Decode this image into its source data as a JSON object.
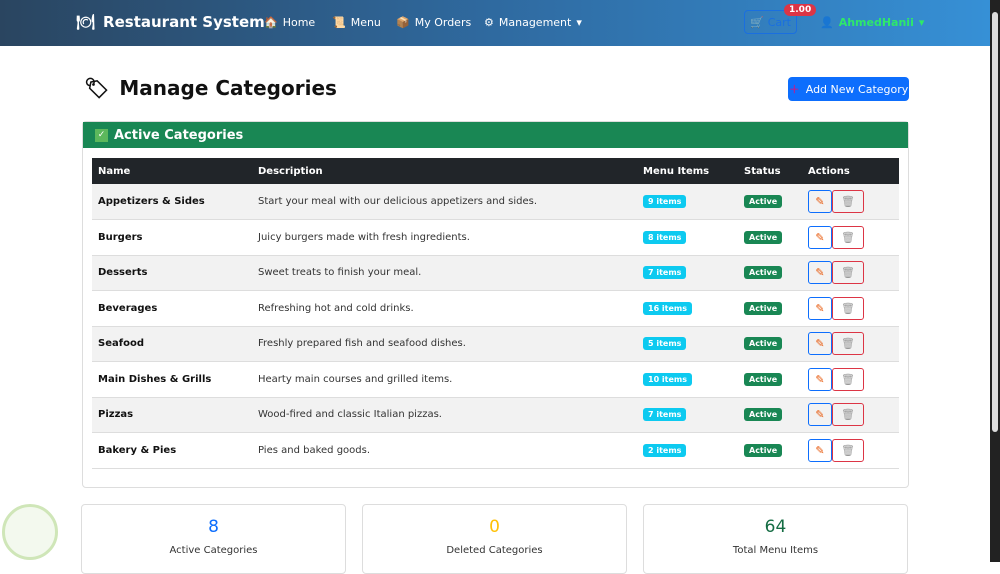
{
  "nav": {
    "brand": "Restaurant System",
    "brand_icon": "🍽",
    "links": [
      {
        "icon": "🏠",
        "label": "Home"
      },
      {
        "icon": "📜",
        "label": "Menu"
      },
      {
        "icon": "📦",
        "label": "My Orders"
      },
      {
        "icon": "⚙",
        "label": "Management"
      }
    ],
    "cart_label": "Cart",
    "cart_badge": "1.00",
    "user": "AhmedHanii"
  },
  "page": {
    "title": "Manage Categories",
    "title_icon": "🏷",
    "add_button": "Add New Category"
  },
  "card": {
    "title": "Active Categories"
  },
  "table": {
    "headers": [
      "Name",
      "Description",
      "Menu Items",
      "Status",
      "Actions"
    ],
    "rows": [
      {
        "name": "Appetizers & Sides",
        "desc": "Start your meal with our delicious appetizers and sides.",
        "items": "9 items",
        "status": "Active"
      },
      {
        "name": "Burgers",
        "desc": "Juicy burgers made with fresh ingredients.",
        "items": "8 items",
        "status": "Active"
      },
      {
        "name": "Desserts",
        "desc": "Sweet treats to finish your meal.",
        "items": "7 items",
        "status": "Active"
      },
      {
        "name": "Beverages",
        "desc": "Refreshing hot and cold drinks.",
        "items": "16 items",
        "status": "Active"
      },
      {
        "name": "Seafood",
        "desc": "Freshly prepared fish and seafood dishes.",
        "items": "5 items",
        "status": "Active"
      },
      {
        "name": "Main Dishes & Grills",
        "desc": "Hearty main courses and grilled items.",
        "items": "10 items",
        "status": "Active"
      },
      {
        "name": "Pizzas",
        "desc": "Wood-fired and classic Italian pizzas.",
        "items": "7 items",
        "status": "Active"
      },
      {
        "name": "Bakery & Pies",
        "desc": "Pies and baked goods.",
        "items": "2 items",
        "status": "Active"
      }
    ]
  },
  "stats": [
    {
      "value": "8",
      "label": "Active Categories",
      "color": "#0d6efd"
    },
    {
      "value": "0",
      "label": "Deleted Categories",
      "color": "#ffc107"
    },
    {
      "value": "64",
      "label": "Total Menu Items",
      "color": "#146c43"
    }
  ]
}
